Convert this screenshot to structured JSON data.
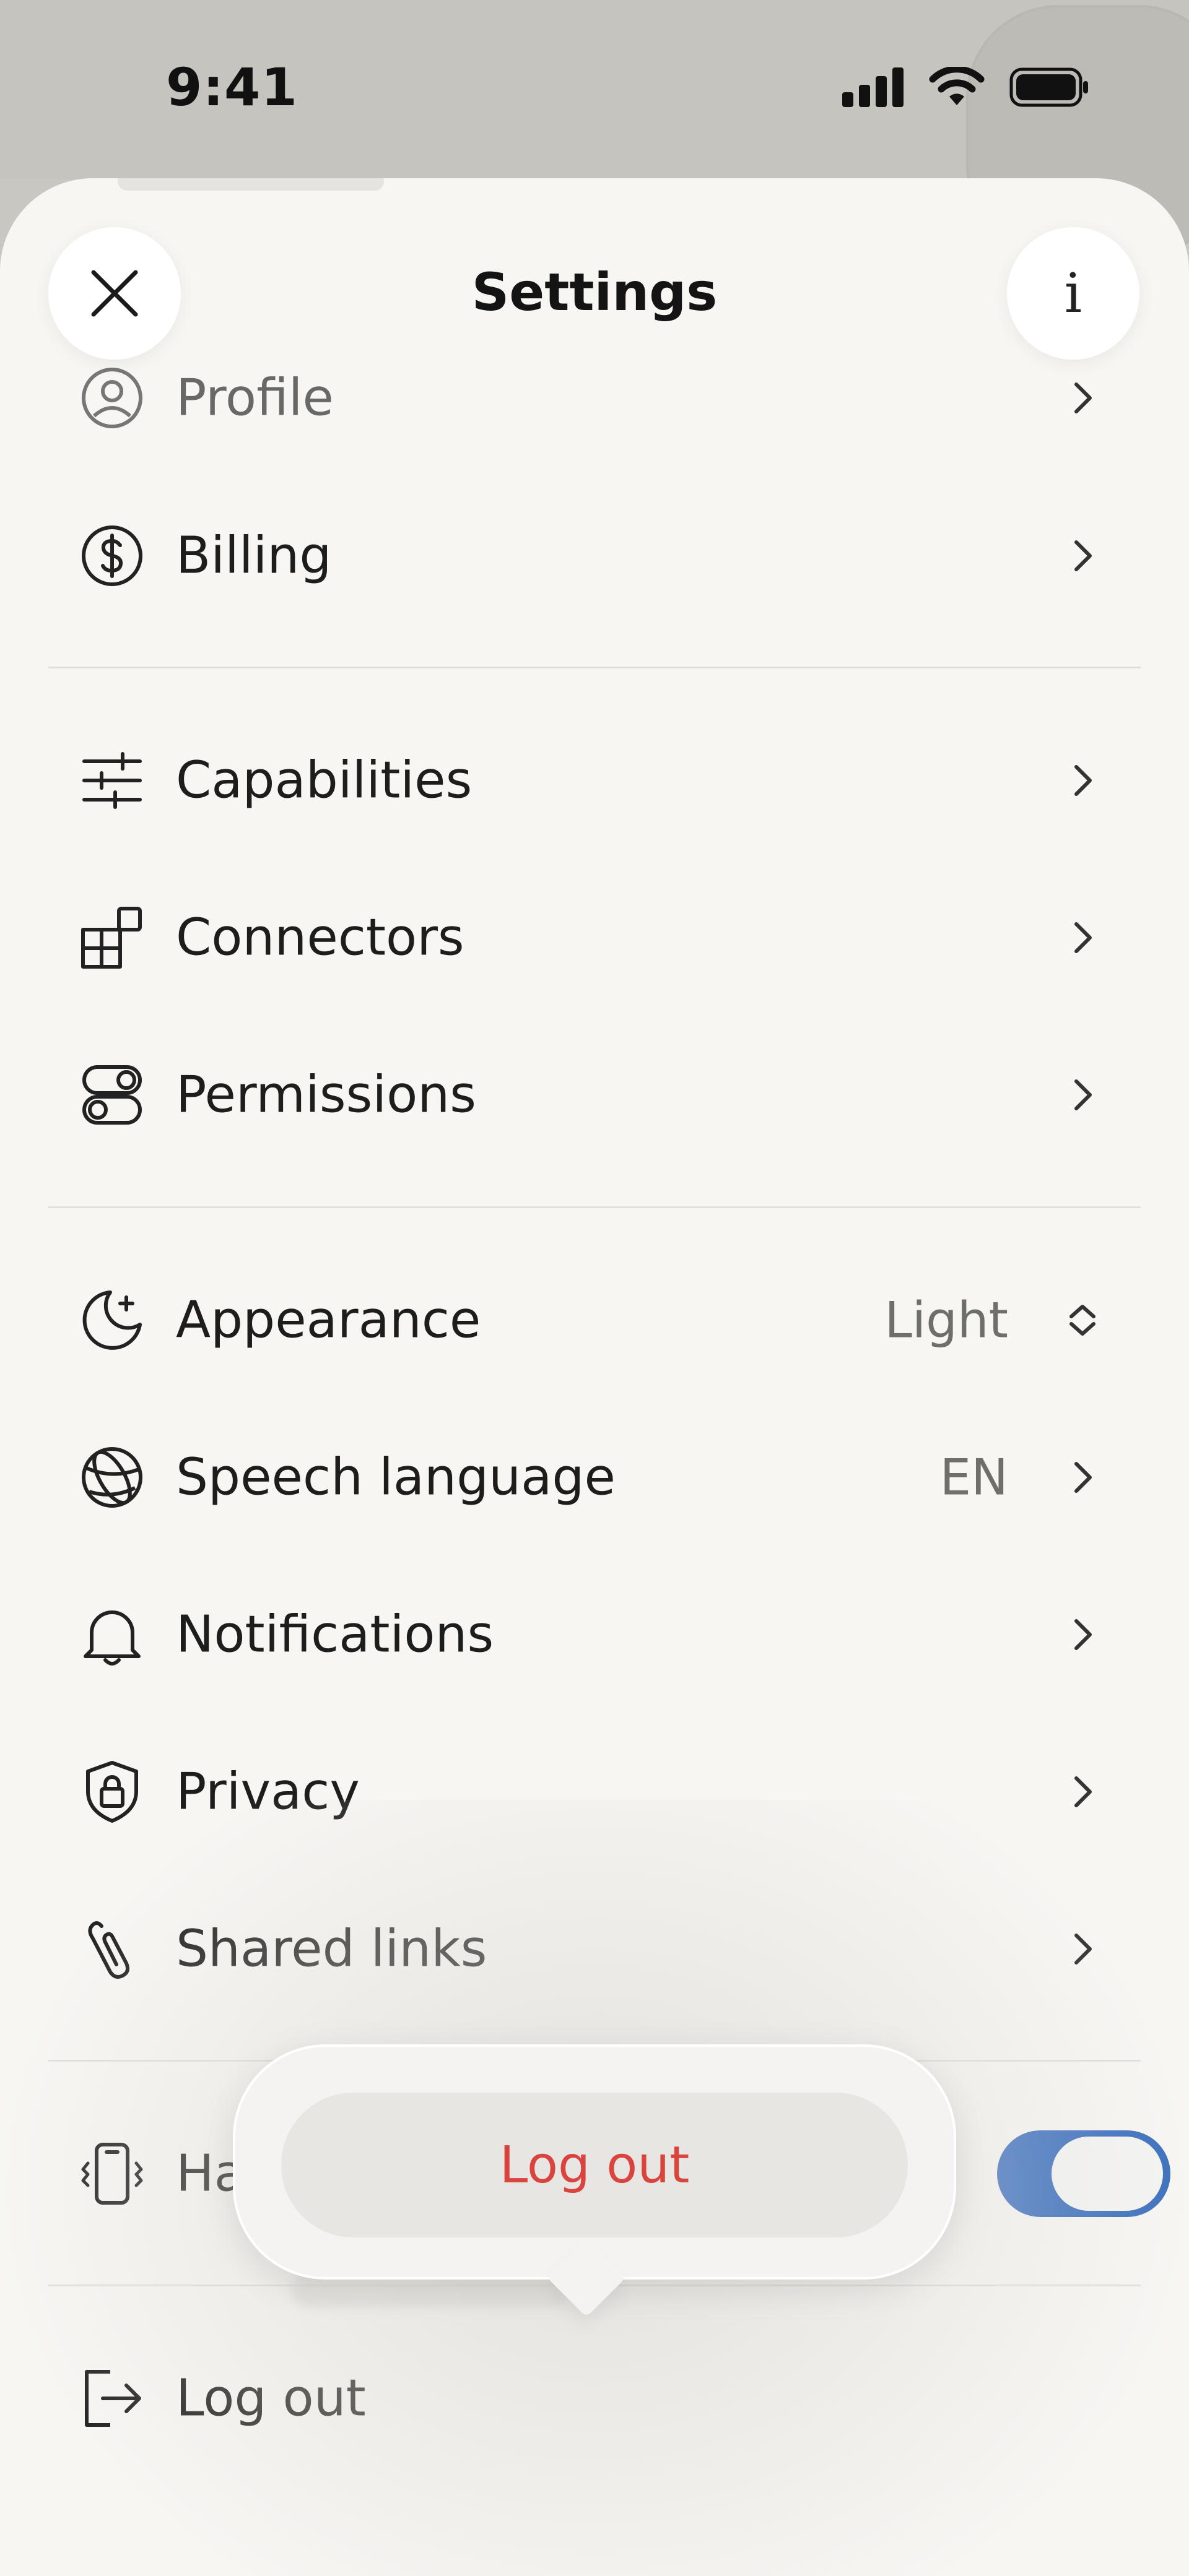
{
  "status_bar": {
    "time": "9:41",
    "icons": [
      "cellular-signal-icon",
      "wifi-icon",
      "battery-icon"
    ]
  },
  "header": {
    "title": "Settings",
    "close_icon": "close-icon",
    "info_label": "i"
  },
  "sections": {
    "account": [
      {
        "label": "Profile",
        "icon": "person-circle-icon"
      },
      {
        "label": "Billing",
        "icon": "dollar-circle-icon"
      }
    ],
    "features": [
      {
        "label": "Capabilities",
        "icon": "sliders-icon"
      },
      {
        "label": "Connectors",
        "icon": "blocks-icon"
      },
      {
        "label": "Permissions",
        "icon": "toggles-icon"
      }
    ],
    "preferences": [
      {
        "label": "Appearance",
        "value": "Light",
        "icon": "moon-sparkle-icon"
      },
      {
        "label": "Speech language",
        "value": "EN",
        "icon": "globe-icon"
      },
      {
        "label": "Notifications",
        "icon": "bell-icon"
      },
      {
        "label": "Privacy",
        "icon": "shield-lock-icon"
      },
      {
        "label": "Shared links",
        "icon": "paperclip-icon"
      }
    ],
    "haptics": {
      "label_visible": "Ha",
      "icon": "phone-vibrate-icon",
      "toggle_on": true
    },
    "logout": {
      "label": "Log out",
      "icon": "logout-icon"
    }
  },
  "popover": {
    "action_label": "Log out"
  },
  "colors": {
    "sheet_bg": "#f7f6f3",
    "status_bg": "#c6c4bf",
    "toggle_on": "#3a6ebd",
    "destructive": "#d9443f"
  }
}
